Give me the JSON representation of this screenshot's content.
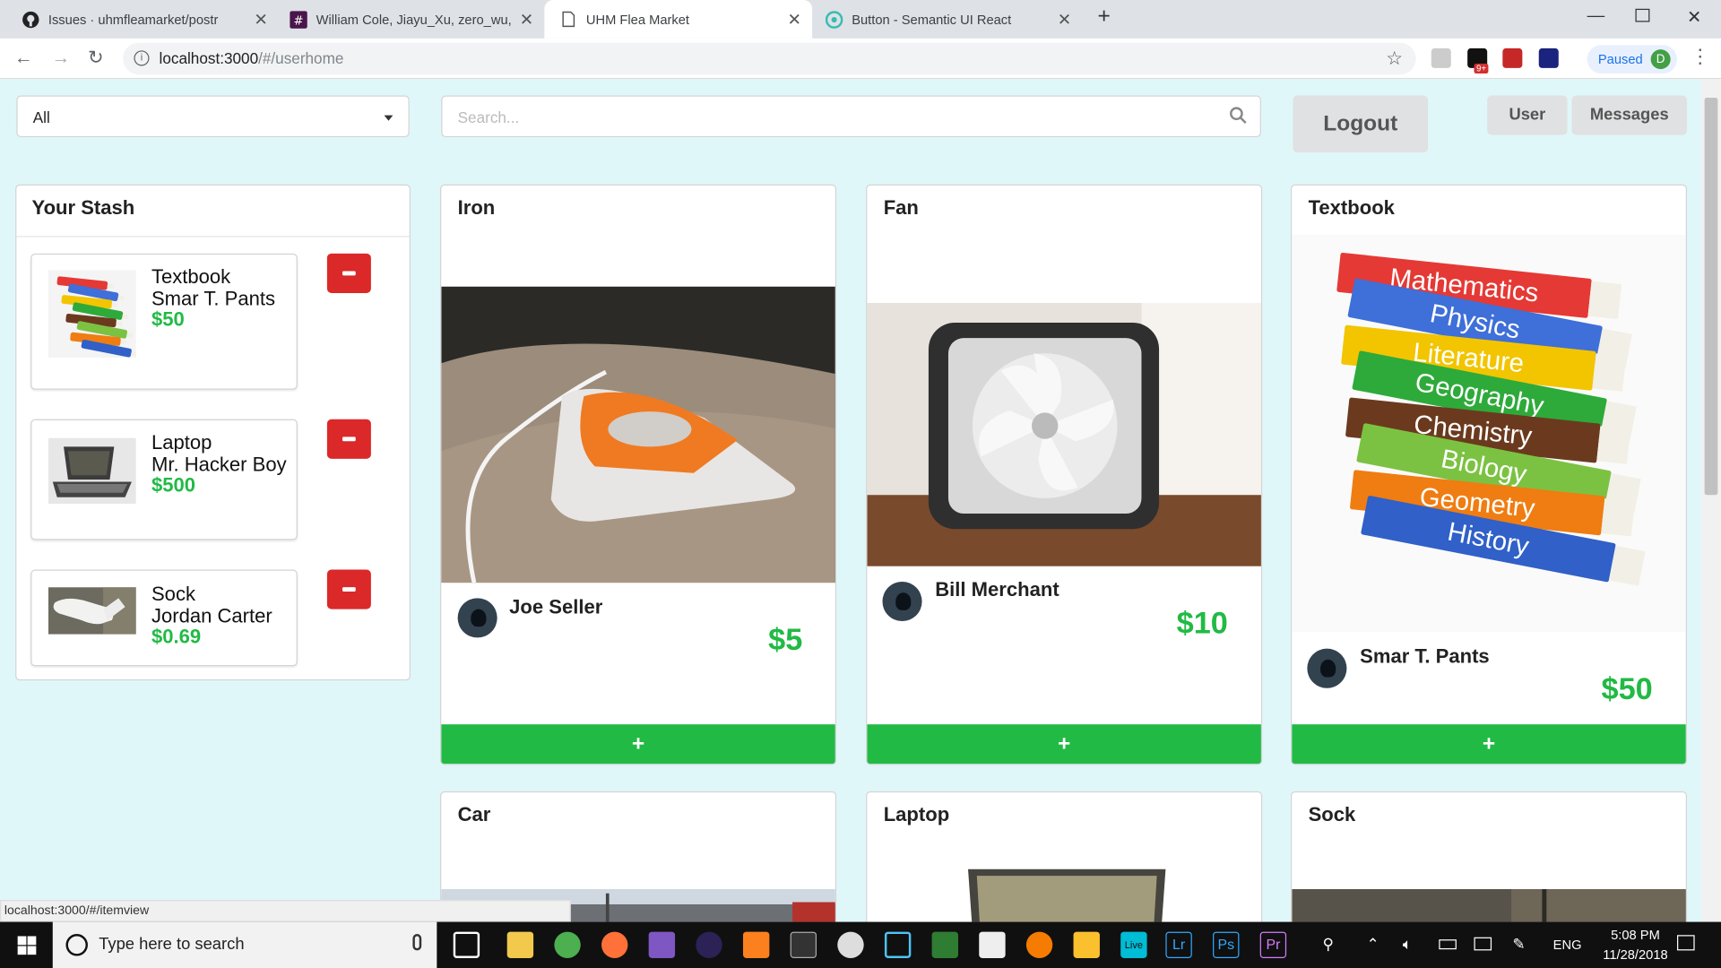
{
  "browser": {
    "tabs": [
      {
        "title": "Issues · uhmfleamarket/postr",
        "icon": "github-icon",
        "active": false
      },
      {
        "title": "William Cole, Jiayu_Xu, zero_wu, ...",
        "icon": "slack-icon",
        "active": false
      },
      {
        "title": "UHM Flea Market",
        "icon": "page-icon",
        "active": true
      },
      {
        "title": "Button - Semantic UI React",
        "icon": "semantic-ui-icon",
        "active": false
      }
    ],
    "url_host": "localhost:3000",
    "url_path": "/#/userhome",
    "profile_status": "Paused",
    "profile_initial": "D",
    "ext_badge": "9+",
    "status_url": "localhost:3000/#/itemview"
  },
  "toolbar": {
    "category_value": "All",
    "search_placeholder": "Search...",
    "logout_label": "Logout",
    "user_label": "User",
    "messages_label": "Messages"
  },
  "stash": {
    "title": "Your Stash",
    "items": [
      {
        "name": "Textbook",
        "seller": "Smar T. Pants",
        "price": "$50"
      },
      {
        "name": "Laptop",
        "seller": "Mr. Hacker Boy",
        "price": "$500"
      },
      {
        "name": "Sock",
        "seller": "Jordan Carter",
        "price": "$0.69"
      }
    ]
  },
  "cards": [
    {
      "title": "Iron",
      "seller": "Joe Seller",
      "price": "$5"
    },
    {
      "title": "Fan",
      "seller": "Bill Merchant",
      "price": "$10"
    },
    {
      "title": "Textbook",
      "seller": "Smar T. Pants",
      "price": "$50"
    },
    {
      "title": "Car"
    },
    {
      "title": "Laptop"
    },
    {
      "title": "Sock"
    }
  ],
  "add_symbol": "+",
  "textbook_spines": [
    "Mathematics",
    "Physics",
    "Literature",
    "Geography",
    "Chemistry",
    "Biology",
    "Geometry",
    "History"
  ],
  "spine_colors": [
    "#e53935",
    "#3f6fd8",
    "#f2c500",
    "#2eaa3a",
    "#6b3a1e",
    "#7cc242",
    "#ef7d12",
    "#3060c8"
  ],
  "taskbar": {
    "search_placeholder": "Type here to search",
    "lang": "ENG",
    "time": "5:08 PM",
    "date": "11/28/2018",
    "app_labels": {
      "live": "Live",
      "lightroom": "Lr",
      "photoshop": "Ps",
      "premiere": "Pr"
    }
  },
  "colors": {
    "accent_green": "#21ba45",
    "remove_red": "#db2828",
    "page_bg": "#e0f7fa"
  }
}
